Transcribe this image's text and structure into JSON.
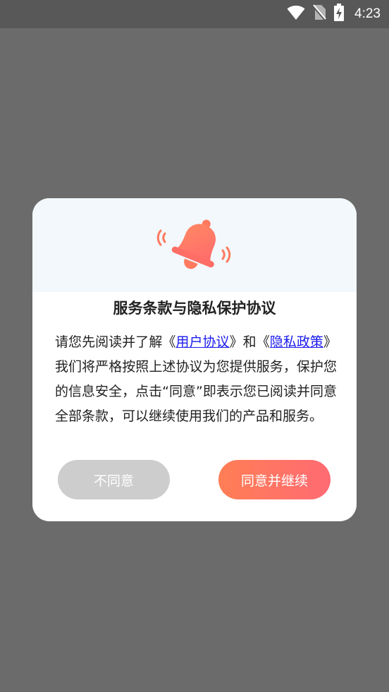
{
  "status_bar": {
    "time": "4:23",
    "icons": [
      "wifi-icon",
      "no-sim-icon",
      "battery-charging-icon"
    ]
  },
  "dialog": {
    "icon": "bell-ringing-icon",
    "title": "服务条款与隐私保护协议",
    "body": {
      "prefix": "请您先阅读并了解《",
      "user_agreement_link": "用户协议",
      "middle": "》和《",
      "privacy_policy_link": "隐私政策",
      "suffix": "》我们将严格按照上述协议为您提供服务，保护您的信息安全，点击“同意”即表示您已阅读并同意全部条款，可以继续使用我们的产品和服务。"
    },
    "disagree_label": "不同意",
    "agree_label": "同意并继续"
  },
  "colors": {
    "accent": "#ff7a5f",
    "link": "#1a1aee",
    "disabled_button": "#cdcdcd",
    "overlay": "#6b6b6b",
    "header_bg": "#f2f8fc"
  }
}
